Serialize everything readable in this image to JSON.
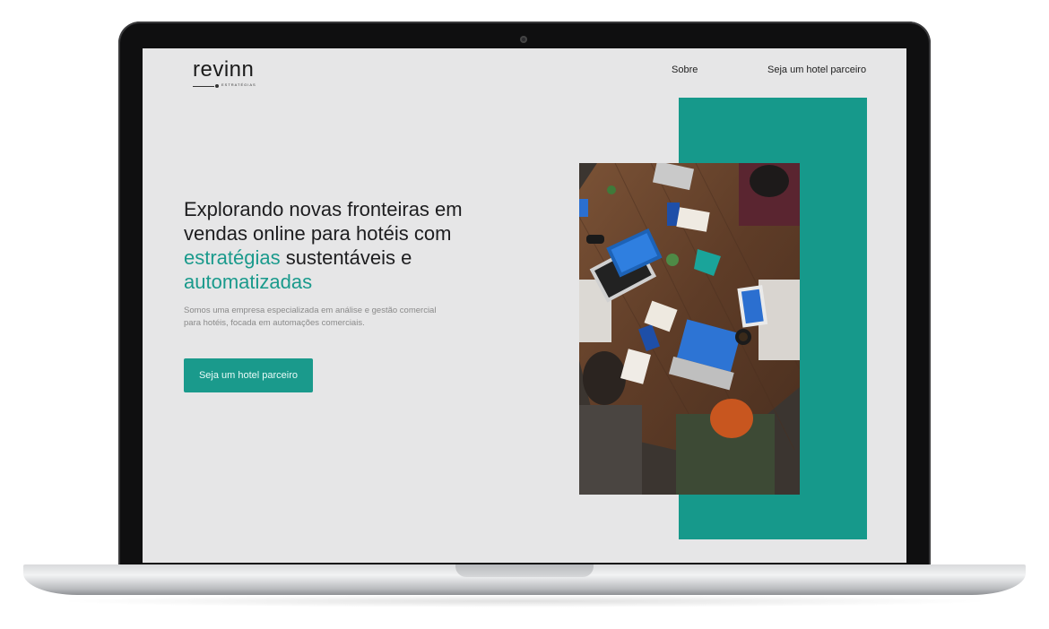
{
  "logo": {
    "name": "revinn",
    "tagline": "ESTRATÉGIAS"
  },
  "nav": {
    "about": "Sobre",
    "partner": "Seja um hotel parceiro"
  },
  "hero": {
    "title_part1": "Explorando novas fronteiras em vendas online para hotéis com ",
    "title_accent1": "estratégias",
    "title_part2": " sustentáveis e ",
    "title_accent2": "automatizadas",
    "description": "Somos uma empresa especializada em análise e gestão comercial para hotéis, focada em automações comerciais.",
    "cta_label": "Seja um hotel parceiro"
  },
  "colors": {
    "accent": "#1a9a8c",
    "teal_block": "#16998b",
    "background": "#e6e6e7"
  }
}
